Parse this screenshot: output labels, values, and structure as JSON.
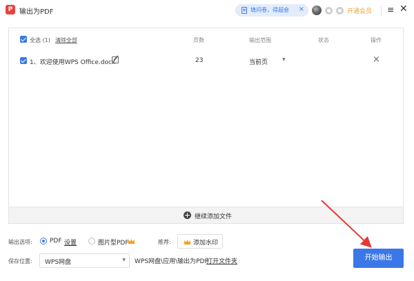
{
  "titlebar": {
    "logo_letter": "P",
    "title": "输出为PDF",
    "survey_text": "填问卷，得超会",
    "survey_close": "×",
    "vip_label": "开通会员",
    "menu_glyph": "≡",
    "close_glyph": "✕"
  },
  "table": {
    "select_all": "全选 (1)",
    "clear_all": "清除全部",
    "columns": {
      "pages": "页数",
      "range": "输出范围",
      "status": "状态",
      "actions": "操作"
    },
    "rows": [
      {
        "name": "1、欢迎使用WPS Office.docx",
        "pages": "23",
        "range": "当前页",
        "status": "",
        "remove": "×"
      }
    ],
    "add_files": "继续添加文件"
  },
  "options": {
    "output_label": "输出选项:",
    "pdf_label": "PDF",
    "settings_link": "设置",
    "image_pdf_label": "图片型PDF",
    "recommend_label": "推荐:",
    "watermark_label": "添加水印",
    "save_label": "保存位置:",
    "location_value": "WPS网盘",
    "path_text": "WPS网盘\\应用\\输出为PDF",
    "open_folder": "打开文件夹",
    "start_button": "开始输出"
  },
  "colors": {
    "accent": "#3b78e7",
    "vip": "#e8a53a",
    "annotation_arrow": "#e53935"
  },
  "icons": [
    "pdf-app-icon",
    "survey-doc-icon",
    "avatar",
    "coin-icon",
    "settings-round-icon",
    "menu-icon",
    "close-icon",
    "checkbox-icon",
    "edit-icon",
    "chevron-down-icon",
    "plus-circle-icon",
    "crown-icon",
    "annotation-arrow"
  ]
}
